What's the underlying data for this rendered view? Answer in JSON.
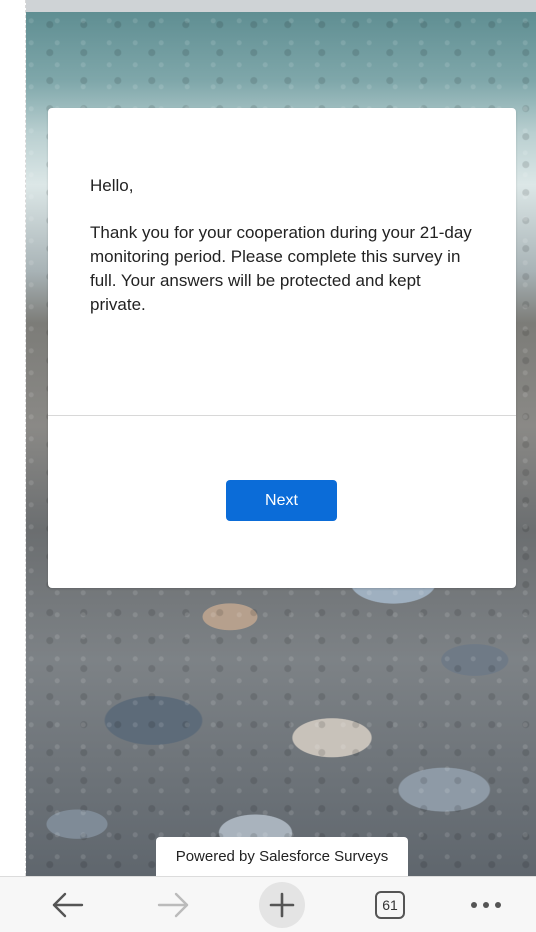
{
  "survey": {
    "greeting": "Hello,",
    "message": "Thank you for your cooperation during your 21-day monitoring period. Please complete this survey in full. Your answers will be protected and kept private.",
    "next_label": "Next"
  },
  "footer": {
    "powered_by": "Powered by Salesforce Surveys"
  },
  "browser_toolbar": {
    "back_icon": "arrow-left-icon",
    "forward_icon": "arrow-right-icon",
    "new_tab_icon": "plus-icon",
    "tab_count": "61",
    "more_icon": "more-dots-icon"
  },
  "colors": {
    "button": "#0b6cd8",
    "toolbar_bg": "#f7f7f7"
  }
}
